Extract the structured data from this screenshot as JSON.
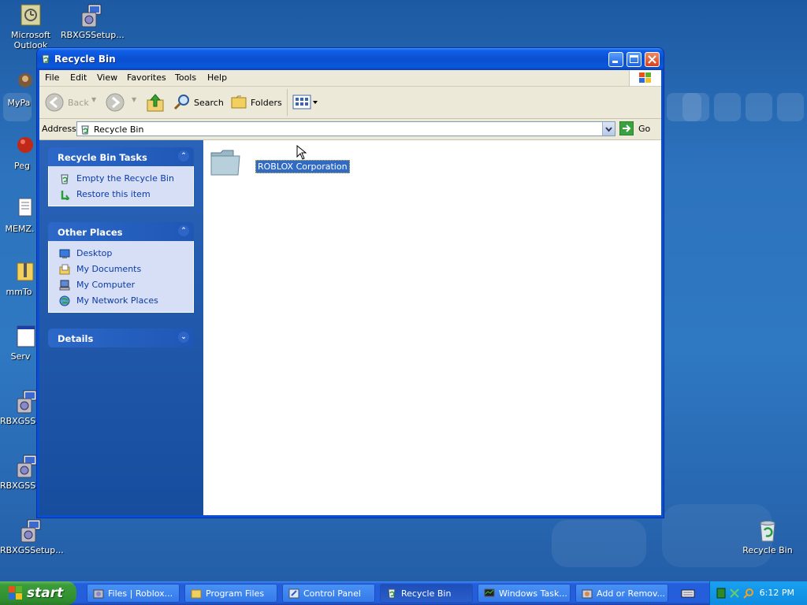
{
  "window": {
    "title": "Recycle Bin",
    "menu": [
      "File",
      "Edit",
      "View",
      "Favorites",
      "Tools",
      "Help"
    ],
    "toolbar": {
      "back": "Back",
      "search": "Search",
      "folders": "Folders"
    },
    "address": {
      "label": "Address",
      "value": "Recycle Bin",
      "go": "Go"
    }
  },
  "taskpane": {
    "tasks": {
      "title": "Recycle Bin Tasks",
      "items": [
        "Empty the Recycle Bin",
        "Restore this item"
      ]
    },
    "places": {
      "title": "Other Places",
      "items": [
        "Desktop",
        "My Documents",
        "My Computer",
        "My Network Places"
      ]
    },
    "details": {
      "title": "Details"
    }
  },
  "content": {
    "items": [
      {
        "label": "ROBLOX Corporation",
        "selected": true
      }
    ]
  },
  "desktop_icons": [
    "Microsoft Outlook",
    "RBXGSSetup...",
    "MyPa",
    "Peg",
    "MEMZ.",
    "mmTo",
    "Serv",
    "RBXGSSe",
    "RBXGSSe",
    "RBXGSSetup...",
    "Recycle Bin"
  ],
  "taskbar": {
    "start": "start",
    "tasks": [
      "Files | Roblox...",
      "Program Files",
      "Control Panel",
      "Recycle Bin",
      "Windows Task...",
      "Add or Remov..."
    ],
    "active_task": "Recycle Bin",
    "clock": "6:12 PM"
  },
  "colors": {
    "titlebar": "#0a4fd0",
    "taskbar": "#245edb",
    "start": "#3c9c3a",
    "selection": "#316ac5",
    "taskpane": "#174d9d"
  }
}
